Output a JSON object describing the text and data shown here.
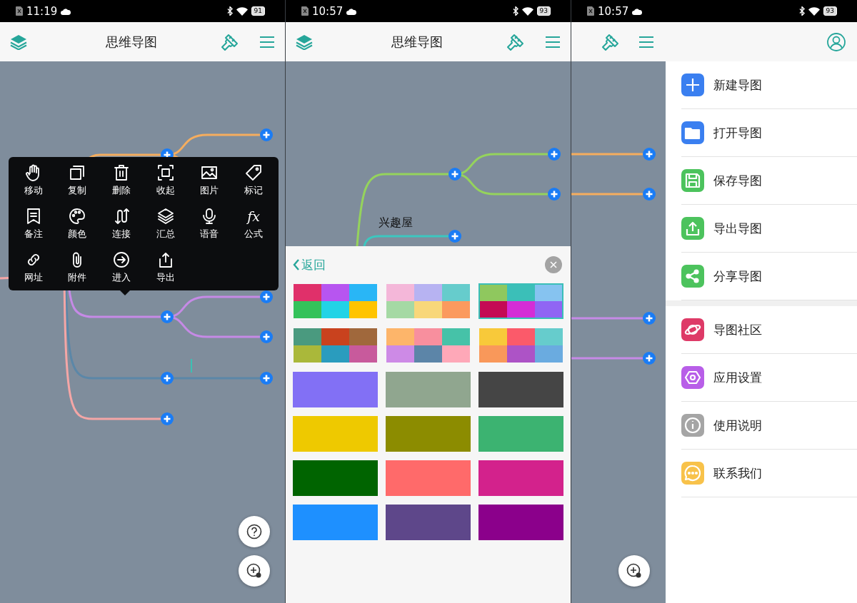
{
  "screens": [
    {
      "status_bar": {
        "time": "11:19",
        "battery": "91"
      },
      "header": {
        "title": "思维导图"
      },
      "node_menu": {
        "items": [
          {
            "label": "移动"
          },
          {
            "label": "复制"
          },
          {
            "label": "删除"
          },
          {
            "label": "收起"
          },
          {
            "label": "图片"
          },
          {
            "label": "标记"
          },
          {
            "label": "备注"
          },
          {
            "label": "颜色"
          },
          {
            "label": "连接"
          },
          {
            "label": "汇总"
          },
          {
            "label": "语音"
          },
          {
            "label": "公式",
            "glyph": "fx"
          },
          {
            "label": "网址"
          },
          {
            "label": "附件"
          },
          {
            "label": "进入"
          },
          {
            "label": "导出"
          }
        ]
      }
    },
    {
      "status_bar": {
        "time": "10:57",
        "battery": "93"
      },
      "header": {
        "title": "思维导图"
      },
      "node_label": "兴趣屋",
      "color_sheet": {
        "back": "返回",
        "swatches": [
          {
            "kind": "palette",
            "selected": false,
            "cells": [
              {
                "color": "#e0306a"
              },
              {
                "color": "#b755f0"
              },
              {
                "color": "#29b6f6"
              },
              {
                "color": "#34c25a"
              },
              {
                "color": "#22d3e6"
              },
              {
                "color": "#ffc400"
              }
            ]
          },
          {
            "kind": "palette",
            "selected": false,
            "cells": [
              {
                "color": "#f4b7d9"
              },
              {
                "color": "#b7b3f2"
              },
              {
                "color": "#66cccc"
              },
              {
                "color": "#a5d9a4"
              },
              {
                "color": "#f8d77a"
              },
              {
                "color": "#fb9a5e"
              }
            ]
          },
          {
            "kind": "palette",
            "selected": true,
            "cells": [
              {
                "color": "#8fc85e"
              },
              {
                "color": "#3bbfb8"
              },
              {
                "color": "#86c3f0"
              },
              {
                "color": "#c40b54"
              },
              {
                "color": "#d42dd6"
              },
              {
                "color": "#9065f4"
              }
            ]
          },
          {
            "kind": "palette",
            "selected": false,
            "cells": [
              {
                "color": "#4a9a7f"
              },
              {
                "color": "#c9421e"
              },
              {
                "color": "#a0683c"
              },
              {
                "color": "#aab83a"
              },
              {
                "color": "#2a9cbe"
              },
              {
                "color": "#c85a9c"
              }
            ]
          },
          {
            "kind": "palette",
            "selected": false,
            "cells": [
              {
                "color": "#fdb56a"
              },
              {
                "color": "#f88f9e"
              },
              {
                "color": "#46c2a8"
              },
              {
                "color": "#cd8ae6"
              },
              {
                "color": "#5c85a8"
              },
              {
                "color": "#fea8b8"
              }
            ]
          },
          {
            "kind": "palette",
            "selected": false,
            "cells": [
              {
                "color": "#f8c93a"
              },
              {
                "color": "#fb5a6a"
              },
              {
                "color": "#66cccc"
              },
              {
                "color": "#f9985a"
              },
              {
                "color": "#ad53c6"
              },
              {
                "color": "#6aabe0"
              }
            ]
          },
          {
            "kind": "solid",
            "selected": false,
            "color": "#8270f5"
          },
          {
            "kind": "solid",
            "selected": false,
            "color": "#90a68f"
          },
          {
            "kind": "solid",
            "selected": false,
            "color": "#454545"
          },
          {
            "kind": "solid",
            "selected": false,
            "color": "#eec900"
          },
          {
            "kind": "solid",
            "selected": false,
            "color": "#8c8c00"
          },
          {
            "kind": "solid",
            "selected": false,
            "color": "#3cb371"
          },
          {
            "kind": "solid",
            "selected": false,
            "color": "#006400"
          },
          {
            "kind": "solid",
            "selected": false,
            "color": "#ff6a6a"
          },
          {
            "kind": "solid",
            "selected": false,
            "color": "#d3228c"
          },
          {
            "kind": "solid",
            "selected": false,
            "color": "#1e90ff"
          },
          {
            "kind": "solid",
            "selected": false,
            "color": "#5e478a"
          },
          {
            "kind": "solid",
            "selected": false,
            "color": "#8b008b"
          }
        ]
      }
    },
    {
      "status_bar": {
        "time": "10:57",
        "battery": "93"
      },
      "drawer": {
        "sections": [
          [
            {
              "label": "新建导图",
              "color": "#3a7ff0"
            },
            {
              "label": "打开导图",
              "color": "#3a7ff0"
            },
            {
              "label": "保存导图",
              "color": "#4cc35d"
            },
            {
              "label": "导出导图",
              "color": "#4cc35d"
            },
            {
              "label": "分享导图",
              "color": "#4cc35d"
            }
          ],
          [
            {
              "label": "导图社区",
              "color": "#de3a67"
            },
            {
              "label": "应用设置",
              "color": "#b85ee8"
            },
            {
              "label": "使用说明",
              "color": "#a5a5a5"
            },
            {
              "label": "联系我们",
              "color": "#f8c24a"
            }
          ]
        ]
      }
    }
  ]
}
